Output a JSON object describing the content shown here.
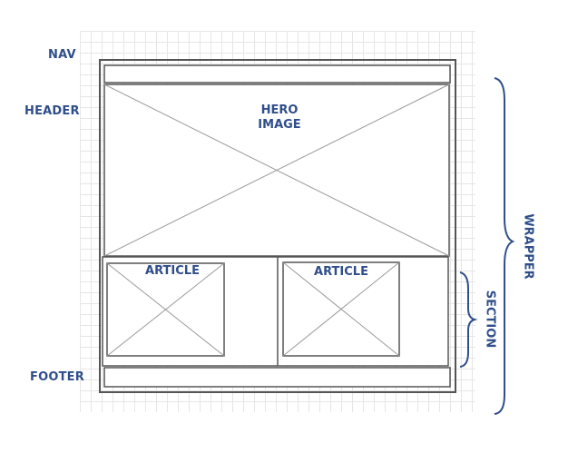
{
  "labels": {
    "nav": "NAV",
    "header": "HEADER",
    "footer": "FOOTER",
    "hero_line1": "HERO",
    "hero_line2": "IMAGE",
    "article_1": "ARTICLE",
    "article_2": "ARTICLE",
    "wrapper": "WRAPPER",
    "section": "SECTION"
  },
  "colors": {
    "label": "#2f4e8a",
    "box_stroke": "#555555",
    "placeholder_line": "#9a9a9a",
    "grid": "#e6e6e6"
  }
}
